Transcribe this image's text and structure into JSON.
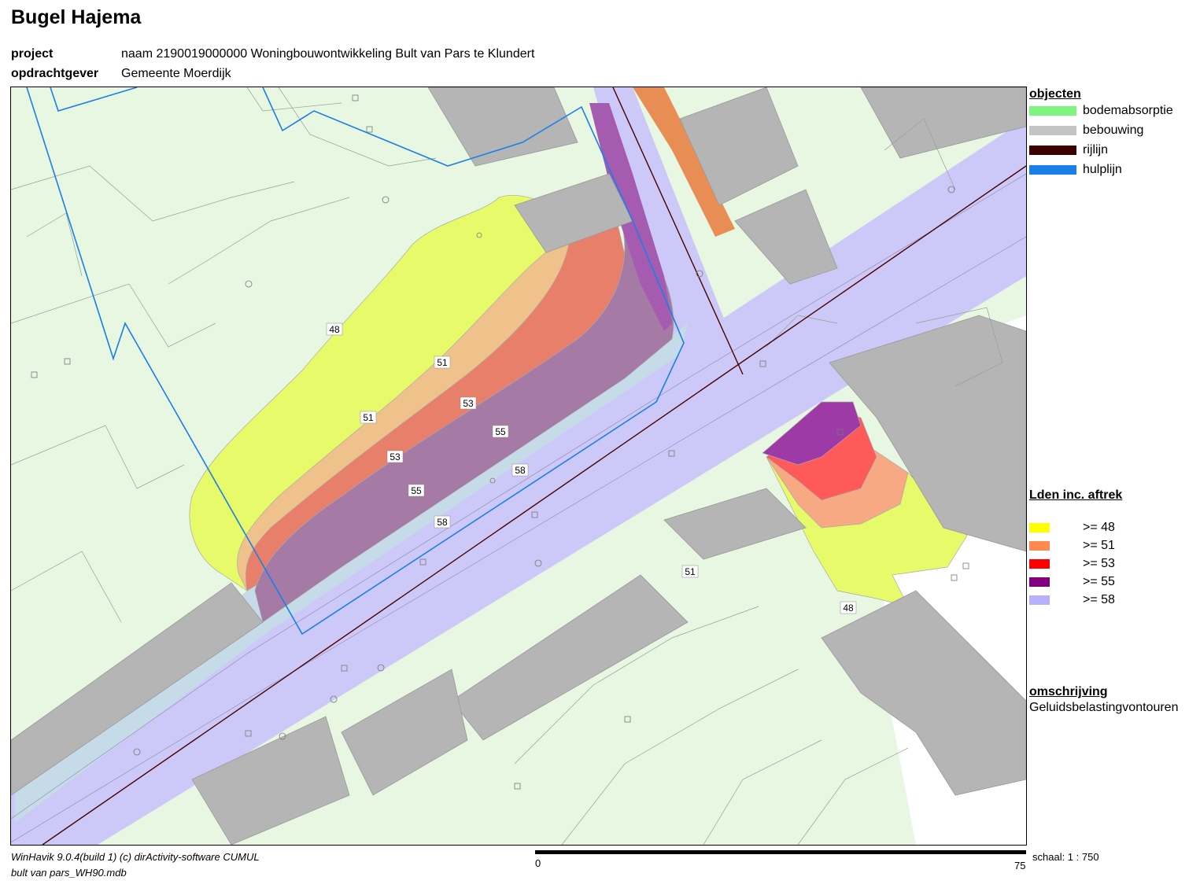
{
  "header": {
    "title": "Bugel Hajema",
    "project_label": "project",
    "project_value": "naam 2190019000000 Woningbouwontwikkeling Bult van Pars te Klundert",
    "client_label": "opdrachtgever",
    "client_value": "Gemeente Moerdijk"
  },
  "legend": {
    "objects_heading": "objecten",
    "objects": [
      {
        "label": "bodemabsorptie",
        "color": "#7ef57e"
      },
      {
        "label": "bebouwing",
        "color": "#c4c4c4"
      },
      {
        "label": "rijlijn",
        "color": "#3d0000"
      },
      {
        "label": "hulplijn",
        "color": "#1a7fe8"
      }
    ],
    "lden_heading": "Lden inc. aftrek",
    "lden": [
      {
        "label": ">= 48",
        "color": "#ffff00"
      },
      {
        "label": ">= 51",
        "color": "#ff8a50"
      },
      {
        "label": ">= 53",
        "color": "#ff0000"
      },
      {
        "label": ">= 55",
        "color": "#800080"
      },
      {
        "label": ">= 58",
        "color": "#b8b0ff"
      }
    ],
    "description_heading": "omschrijving",
    "description": "Geluidsbelastingvontouren"
  },
  "map": {
    "contour_labels": [
      "48",
      "51",
      "51",
      "53",
      "53",
      "55",
      "55",
      "58",
      "58",
      "51",
      "48"
    ]
  },
  "footer": {
    "software": "WinHavik 9.0.4(build 1) (c) dirActivity-software    CUMUL",
    "file": "bult van pars_WH90.mdb",
    "scale_start": "0",
    "scale_end": "75",
    "scale_text": "schaal:  1 : 750"
  }
}
